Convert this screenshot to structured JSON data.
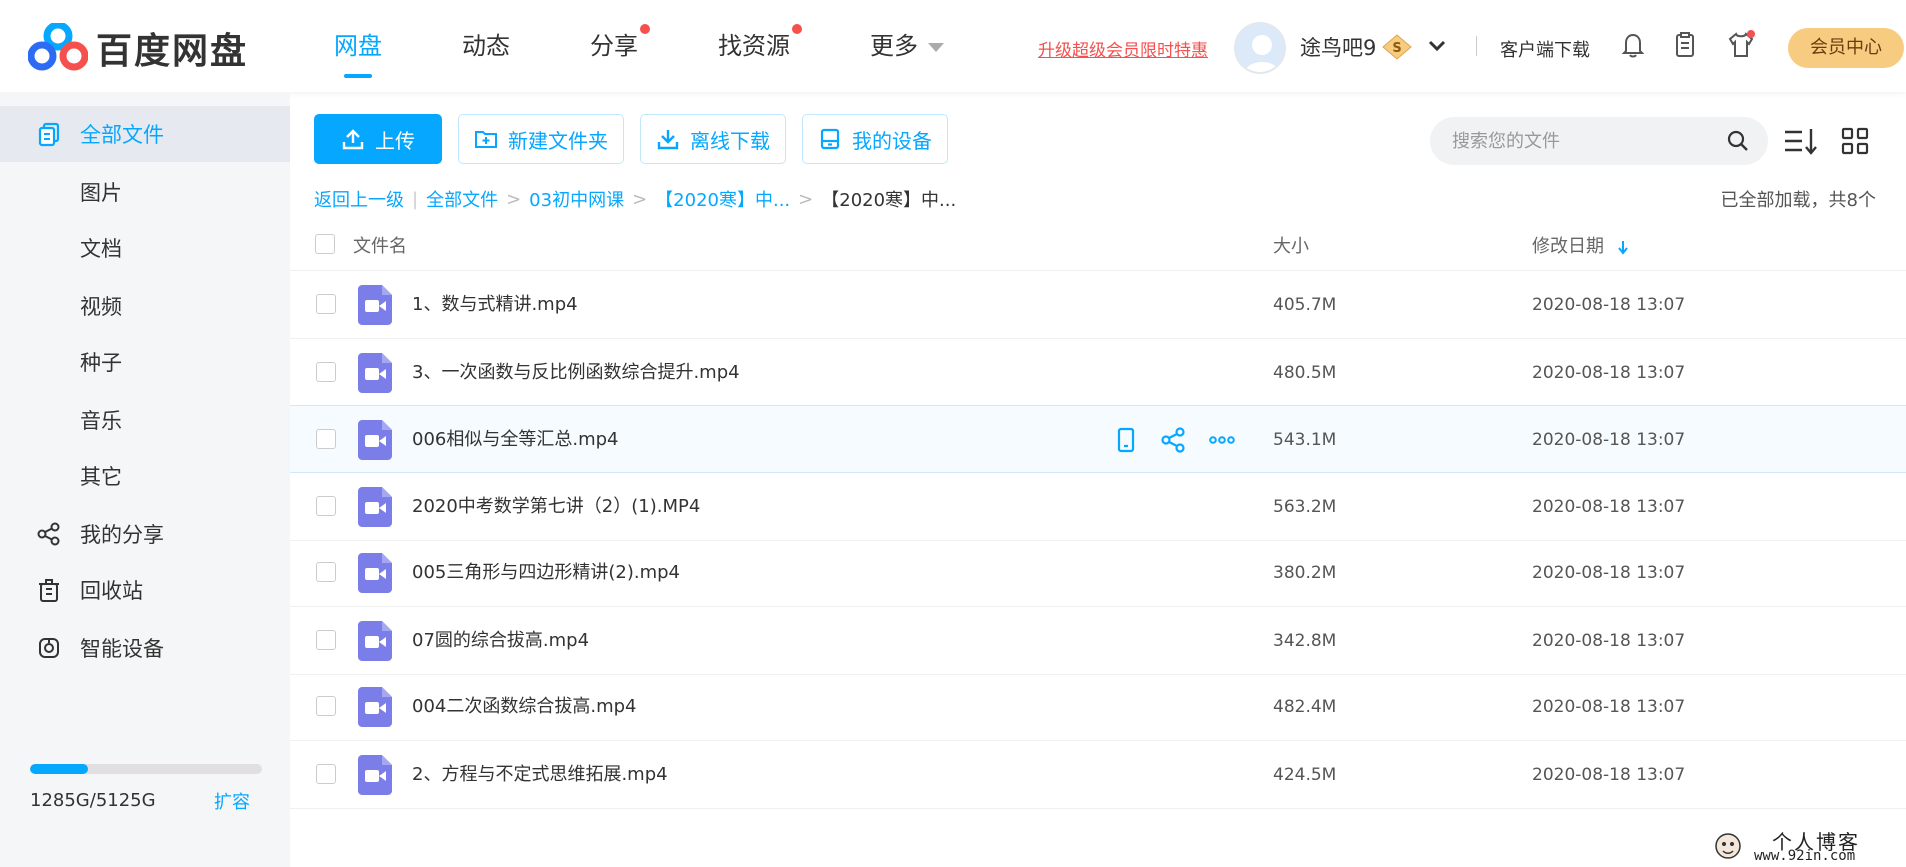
{
  "header": {
    "logo_text": "百度网盘",
    "nav": [
      {
        "label": "网盘",
        "active": true,
        "dot": false
      },
      {
        "label": "动态",
        "active": false,
        "dot": false
      },
      {
        "label": "分享",
        "active": false,
        "dot": true
      },
      {
        "label": "找资源",
        "active": false,
        "dot": true
      },
      {
        "label": "更多",
        "active": false,
        "dot": false
      }
    ],
    "promo": "升级超级会员限时特惠",
    "username": "途鸟吧9",
    "vip_badge": "S",
    "client_download": "客户端下载",
    "vip_center": "会员中心"
  },
  "sidebar": {
    "items": [
      {
        "label": "全部文件",
        "icon": "all-files-icon"
      },
      {
        "label": "图片"
      },
      {
        "label": "文档"
      },
      {
        "label": "视频"
      },
      {
        "label": "种子"
      },
      {
        "label": "音乐"
      },
      {
        "label": "其它"
      },
      {
        "label": "我的分享",
        "icon": "share-icon"
      },
      {
        "label": "回收站",
        "icon": "trash-icon"
      },
      {
        "label": "智能设备",
        "icon": "smart-device-icon"
      }
    ],
    "storage": {
      "used_fraction": 0.25,
      "text": "1285G/5125G",
      "expand": "扩容"
    }
  },
  "toolbar": {
    "upload": "上传",
    "new_folder": "新建文件夹",
    "offline_download": "离线下载",
    "my_devices": "我的设备",
    "search_placeholder": "搜索您的文件"
  },
  "breadcrumb": {
    "back": "返回上一级",
    "items": [
      "全部文件",
      "03初中网课",
      "【2020寒】中..."
    ],
    "current": "【2020寒】中...",
    "loaded_info": "已全部加载，共8个"
  },
  "table": {
    "headers": {
      "name": "文件名",
      "size": "大小",
      "modified": "修改日期"
    },
    "rows": [
      {
        "name": "1、数与式精讲.mp4",
        "size": "405.7M",
        "date": "2020-08-18 13:07"
      },
      {
        "name": "3、一次函数与反比例函数综合提升.mp4",
        "size": "480.5M",
        "date": "2020-08-18 13:07"
      },
      {
        "name": "006相似与全等汇总.mp4",
        "size": "543.1M",
        "date": "2020-08-18 13:07"
      },
      {
        "name": "2020中考数学第七讲（2）(1).MP4",
        "size": "563.2M",
        "date": "2020-08-18 13:07"
      },
      {
        "name": "005三角形与四边形精讲(2).mp4",
        "size": "380.2M",
        "date": "2020-08-18 13:07"
      },
      {
        "name": "07圆的综合拔高.mp4",
        "size": "342.8M",
        "date": "2020-08-18 13:07"
      },
      {
        "name": "004二次函数综合拔高.mp4",
        "size": "482.4M",
        "date": "2020-08-18 13:07"
      },
      {
        "name": "2、方程与不定式思维拓展.mp4",
        "size": "424.5M",
        "date": "2020-08-18 13:07"
      }
    ]
  },
  "watermark": {
    "line1": "个人博客",
    "line2": "www.92in.com"
  },
  "colors": {
    "accent": "#06a7ff",
    "red": "#f5504e",
    "vip": "#f7cb80",
    "video_icon": "#7b7de8"
  }
}
